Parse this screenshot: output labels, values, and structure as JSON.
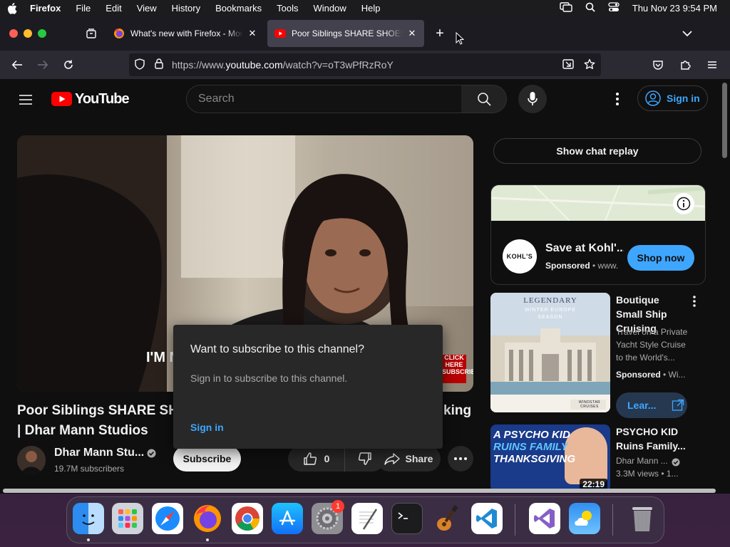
{
  "menubar": {
    "app_name": "Firefox",
    "menus": [
      "File",
      "Edit",
      "View",
      "History",
      "Bookmarks",
      "Tools",
      "Window",
      "Help"
    ],
    "clock": "Thu Nov 23  9:54 PM"
  },
  "tabs": [
    {
      "title": "What's new with Firefox - More",
      "favicon": "firefox-icon"
    },
    {
      "title": "Poor Siblings SHARE SHOES for",
      "favicon": "youtube-icon"
    }
  ],
  "urlbar": {
    "prefix": "https://www.",
    "host": "youtube.com",
    "path": "/watch?v=oT3wPfRzRoY"
  },
  "youtube": {
    "logo_text": "YouTube",
    "search_placeholder": "Search",
    "sign_in": "Sign in"
  },
  "video": {
    "overlay_text": "I'M N",
    "click_here": "CLICK HERE SUBSCRIBE",
    "title_line1_left": "Poor Siblings SHARE SHO",
    "title_line1_right": "king",
    "title_line2": "| Dhar Mann Studios",
    "channel": "Dhar Mann Stu...",
    "subscribers": "19.7M subscribers",
    "subscribe": "Subscribe",
    "likes": "0",
    "share": "Share"
  },
  "popup": {
    "title": "Want to subscribe to this channel?",
    "body": "Sign in to subscribe to this channel.",
    "link": "Sign in"
  },
  "sidebar": {
    "chat_replay": "Show chat replay",
    "ad": {
      "logo": "KOHL'S",
      "title": "Save at Kohl'...",
      "sponsored": "Sponsored",
      "domain": "www.",
      "cta": "Shop now"
    },
    "promo": {
      "thumb_line1": "LEGENDARY",
      "thumb_line2": "WINTER EUROPE SEASON",
      "thumb_brand": "WINDSTAR CRUISES",
      "title": "Boutique Small Ship Cruising",
      "desc": "Travel on a Private Yacht Style Cruise to the World's...",
      "sponsored": "Sponsored",
      "meta_tail": "Wi...",
      "cta": "Lear..."
    },
    "rec": {
      "thumb_line1": "A PSYCHO KID",
      "thumb_line2": "RUINS FAMILY",
      "thumb_line3": "THANKSGIVING",
      "duration": "22:19",
      "title": "PSYCHO KID Ruins Family...",
      "channel": "Dhar Mann ...",
      "meta": "3.3M views  •  1..."
    }
  },
  "dock": {
    "settings_badge": "1"
  },
  "colors": {
    "yt_red": "#ff0000",
    "link_blue": "#3ea6ff",
    "bg": "#0f0f0f"
  }
}
